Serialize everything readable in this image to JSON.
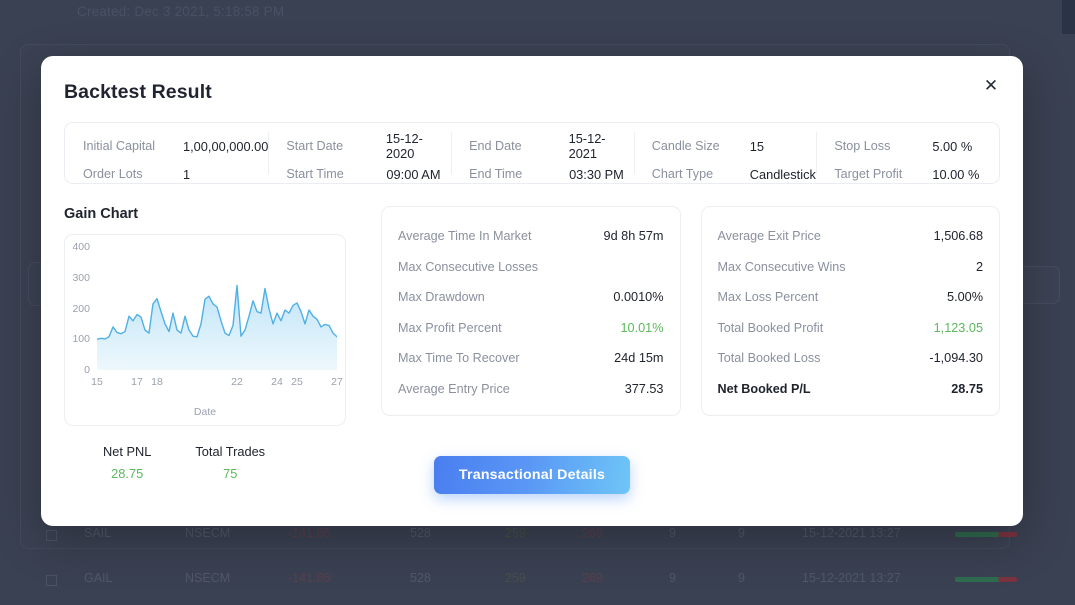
{
  "backdrop": {
    "created_text": "Created: Dec 3 2021, 5:18:58 PM",
    "table_rows": [
      {
        "symbol": "SAIL",
        "exchange": "NSECM",
        "pnl": "-141.85",
        "qty": "528",
        "entry": "259",
        "exit": "269",
        "c1": "9",
        "c2": "9",
        "datetime": "15-12-2021  13:27"
      },
      {
        "symbol": "GAIL",
        "exchange": "NSECM",
        "pnl": "-141.85",
        "qty": "528",
        "entry": "259",
        "exit": "269",
        "c1": "9",
        "c2": "9",
        "datetime": "15-12-2021  13:27"
      }
    ]
  },
  "modal": {
    "title": "Backtest Result",
    "close_label": "✕"
  },
  "info": {
    "groups": [
      {
        "rows": [
          {
            "label": "Initial Capital",
            "value": "1,00,00,000.00"
          },
          {
            "label": "Order Lots",
            "value": "1"
          }
        ]
      },
      {
        "rows": [
          {
            "label": "Start Date",
            "value": "15-12-2020"
          },
          {
            "label": "Start Time",
            "value": "09:00 AM"
          }
        ]
      },
      {
        "rows": [
          {
            "label": "End Date",
            "value": "15-12-2021"
          },
          {
            "label": "End Time",
            "value": "03:30 PM"
          }
        ]
      },
      {
        "rows": [
          {
            "label": "Candle Size",
            "value": "15"
          },
          {
            "label": "Chart Type",
            "value": "Candlestick"
          }
        ]
      },
      {
        "rows": [
          {
            "label": "Stop Loss",
            "value": "5.00 %"
          },
          {
            "label": "Target Profit",
            "value": "10.00 %"
          }
        ]
      }
    ]
  },
  "chart": {
    "title": "Gain Chart"
  },
  "chart_data": {
    "type": "area",
    "title": "Gain Chart",
    "xlabel": "Date",
    "ylabel": "",
    "ylim": [
      0,
      400
    ],
    "xlim": [
      15,
      27
    ],
    "yticks": [
      0,
      100,
      200,
      300,
      400
    ],
    "xticks": [
      15,
      17,
      18,
      22,
      24,
      25,
      27
    ],
    "grid": false,
    "legend": "none",
    "line_color": "#4fb0e5",
    "fill_color": "#d2ecfa",
    "x": [
      15.0,
      15.2,
      15.4,
      15.6,
      15.8,
      16.0,
      16.2,
      16.4,
      16.6,
      16.8,
      17.0,
      17.2,
      17.4,
      17.6,
      17.8,
      18.0,
      18.2,
      18.4,
      18.6,
      18.8,
      19.0,
      19.2,
      19.4,
      19.6,
      19.8,
      20.0,
      20.2,
      20.4,
      20.6,
      20.8,
      21.0,
      21.2,
      21.4,
      21.6,
      21.8,
      22.0,
      22.2,
      22.4,
      22.6,
      22.8,
      23.0,
      23.2,
      23.4,
      23.6,
      23.8,
      24.0,
      24.2,
      24.4,
      24.6,
      24.8,
      25.0,
      25.2,
      25.4,
      25.6,
      25.8,
      26.0,
      26.2,
      26.4,
      26.6,
      26.8,
      27.0
    ],
    "values": [
      100,
      103,
      101,
      108,
      140,
      122,
      118,
      125,
      175,
      160,
      180,
      172,
      130,
      120,
      215,
      232,
      190,
      150,
      125,
      185,
      130,
      120,
      175,
      130,
      110,
      108,
      150,
      230,
      240,
      215,
      205,
      160,
      120,
      112,
      145,
      275,
      110,
      130,
      175,
      225,
      190,
      185,
      265,
      200,
      150,
      185,
      160,
      195,
      185,
      210,
      218,
      190,
      150,
      195,
      175,
      165,
      140,
      148,
      145,
      120,
      108
    ]
  },
  "stats_middle": [
    {
      "label": "Average Time In Market",
      "value": "9d 8h 57m",
      "style": "normal"
    },
    {
      "label": "Max Consecutive Losses",
      "value": "",
      "style": "normal"
    },
    {
      "label": "Max Drawdown",
      "value": "0.0010%",
      "style": "normal"
    },
    {
      "label": "Max Profit Percent",
      "value": "10.01%",
      "style": "green"
    },
    {
      "label": "Max Time To Recover",
      "value": "24d 15m",
      "style": "normal"
    },
    {
      "label": "Average Entry Price",
      "value": "377.53",
      "style": "normal"
    }
  ],
  "stats_right": [
    {
      "label": "Average Exit Price",
      "value": "1,506.68",
      "style": "normal"
    },
    {
      "label": "Max Consecutive Wins",
      "value": "2",
      "style": "normal"
    },
    {
      "label": "Max Loss Percent",
      "value": "5.00%",
      "style": "normal"
    },
    {
      "label": "Total Booked Profit",
      "value": "1,123.05",
      "style": "green"
    },
    {
      "label": "Total Booked Loss",
      "value": "-1,094.30",
      "style": "normal"
    },
    {
      "label": "Net Booked P/L",
      "value": "28.75",
      "style": "bold"
    }
  ],
  "summary": [
    {
      "label": "Net PNL",
      "value": "28.75"
    },
    {
      "label": "Total Trades",
      "value": "75"
    }
  ],
  "cta": {
    "label": "Transactional Details"
  },
  "colors": {
    "accent_blue": "#5a97f5",
    "chart_line": "#4fb0e5",
    "green": "#5cb85c",
    "overlay": "#3a4152"
  }
}
